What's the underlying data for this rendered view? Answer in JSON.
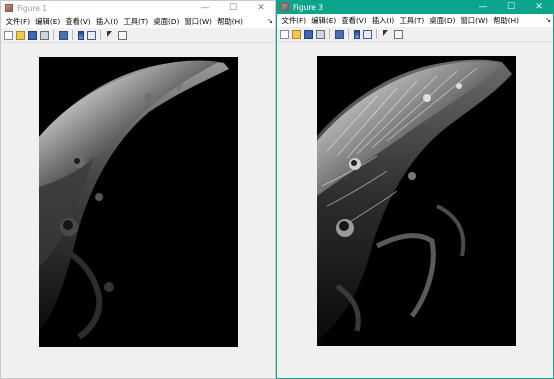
{
  "windows": [
    {
      "title": "Figure 1",
      "controls": {
        "minimize": "—",
        "maximize": "☐",
        "close": "✕"
      },
      "menu": [
        "文件(F)",
        "编辑(E)",
        "查看(V)",
        "插入(I)",
        "工具(T)",
        "桌面(D)",
        "窗口(W)",
        "帮助(H)"
      ],
      "menu_overflow": "↘",
      "toolbar_icons": [
        "new-figure-icon",
        "open-file-icon",
        "save-icon",
        "print-icon",
        "zoom-icon",
        "colorbar-icon",
        "legend-icon",
        "edit-plot-icon",
        "property-inspector-icon"
      ],
      "image": "grayscale moon crater photo"
    },
    {
      "title": "Figure 3",
      "controls": {
        "minimize": "—",
        "maximize": "☐",
        "close": "✕"
      },
      "menu": [
        "文件(F)",
        "编辑(E)",
        "查看(V)",
        "插入(I)",
        "工具(T)",
        "桌面(D)",
        "窗口(W)",
        "帮助(H)"
      ],
      "menu_overflow": "↘",
      "toolbar_icons": [
        "new-figure-icon",
        "open-file-icon",
        "save-icon",
        "print-icon",
        "zoom-icon",
        "colorbar-icon",
        "legend-icon",
        "edit-plot-icon",
        "property-inspector-icon"
      ],
      "image": "edge-enhanced moon crater photo"
    }
  ],
  "colors": {
    "active_title": "#0ba58b",
    "inactive_title": "#ffffff"
  }
}
